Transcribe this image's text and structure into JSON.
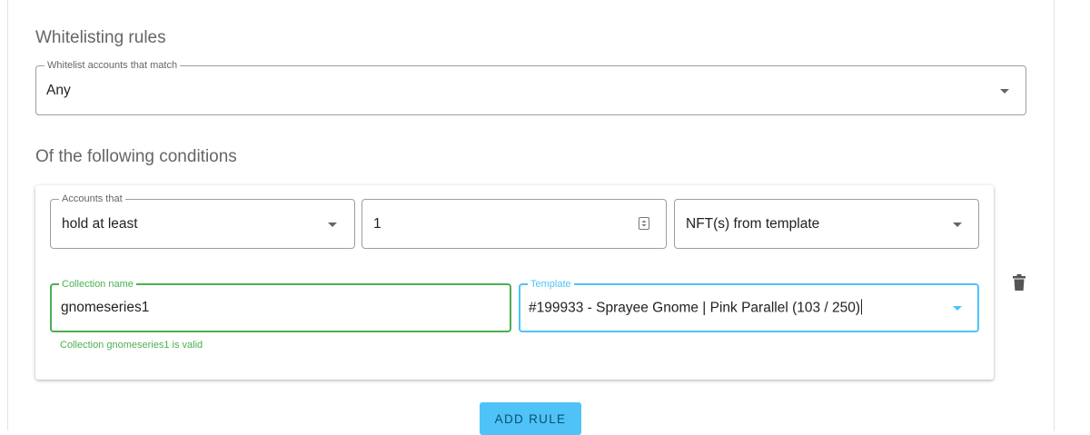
{
  "whitelisting": {
    "title": "Whitelisting rules",
    "match_field": {
      "label": "Whitelist accounts that match",
      "value": "Any"
    }
  },
  "conditions": {
    "title": "Of the following conditions",
    "rule": {
      "accounts_field": {
        "label": "Accounts that",
        "value": "hold at least"
      },
      "quantity_field": {
        "value": "1"
      },
      "type_field": {
        "value": "NFT(s) from template"
      },
      "collection_field": {
        "label": "Collection name",
        "value": "gnomeseries1",
        "helper": "Collection gnomeseries1 is valid"
      },
      "template_field": {
        "label": "Template",
        "value": "#199933 - Sprayee Gnome | Pink Parallel (103 / 250)"
      }
    }
  },
  "actions": {
    "add_rule_label": "ADD RULE"
  },
  "colors": {
    "valid": "#4caf50",
    "focus": "#4fc3f7",
    "button": "#4fc3f7"
  },
  "icons": {
    "quantity": "number-spin-icon",
    "delete": "trash-icon",
    "dropdown": "caret-down-icon"
  }
}
